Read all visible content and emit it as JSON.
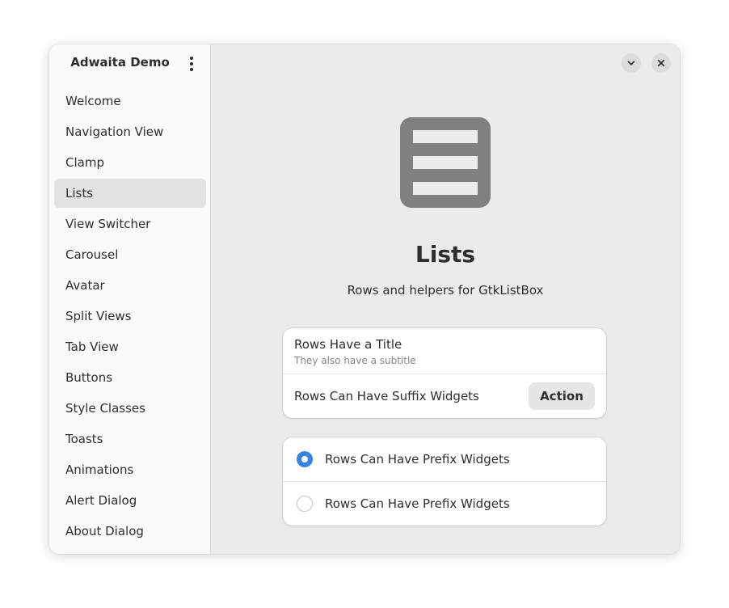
{
  "sidebar": {
    "title": "Adwaita Demo",
    "menu_icon": "view-more-icon",
    "items": [
      {
        "label": "Welcome",
        "selected": false
      },
      {
        "label": "Navigation View",
        "selected": false
      },
      {
        "label": "Clamp",
        "selected": false
      },
      {
        "label": "Lists",
        "selected": true
      },
      {
        "label": "View Switcher",
        "selected": false
      },
      {
        "label": "Carousel",
        "selected": false
      },
      {
        "label": "Avatar",
        "selected": false
      },
      {
        "label": "Split Views",
        "selected": false
      },
      {
        "label": "Tab View",
        "selected": false
      },
      {
        "label": "Buttons",
        "selected": false
      },
      {
        "label": "Style Classes",
        "selected": false
      },
      {
        "label": "Toasts",
        "selected": false
      },
      {
        "label": "Animations",
        "selected": false
      },
      {
        "label": "Alert Dialog",
        "selected": false
      },
      {
        "label": "About Dialog",
        "selected": false
      }
    ]
  },
  "header": {
    "minimize_icon": "chevron-down-icon",
    "close_icon": "close-icon"
  },
  "page": {
    "icon": "list-icon",
    "title": "Lists",
    "description": "Rows and helpers for GtkListBox"
  },
  "card1": {
    "row1": {
      "title": "Rows Have a Title",
      "subtitle": "They also have a subtitle"
    },
    "row2": {
      "title": "Rows Can Have Suffix Widgets",
      "button_label": "Action"
    }
  },
  "card2": {
    "rows": [
      {
        "label": "Rows Can Have Prefix Widgets",
        "checked": true
      },
      {
        "label": "Rows Can Have Prefix Widgets",
        "checked": false
      }
    ]
  },
  "colors": {
    "accent": "#3584e4",
    "sidebar_bg": "#fafafb",
    "content_bg": "#ebebed",
    "selected_item_bg": "#e2e2e5",
    "icon_gray": "#808080"
  }
}
